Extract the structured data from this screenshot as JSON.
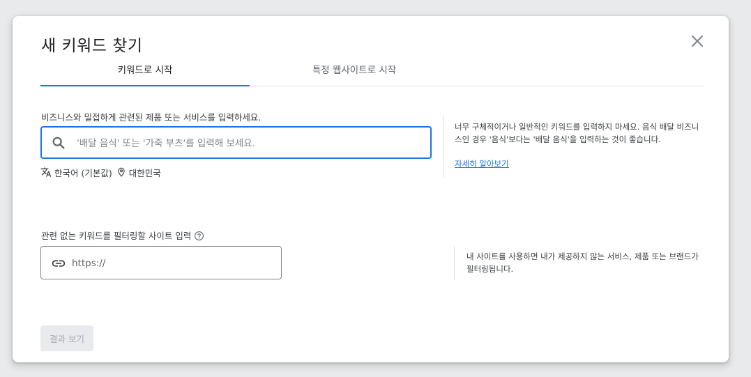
{
  "dialog": {
    "title": "새 키워드 찾기",
    "close_icon": "close-icon"
  },
  "tabs": [
    {
      "label": "키워드로 시작",
      "active": true
    },
    {
      "label": "특정 웹사이트로 시작",
      "active": false
    }
  ],
  "keyword_section": {
    "label": "비즈니스와 밀접하게 관련된 제품 또는 서비스를 입력하세요.",
    "search_placeholder": "'배달 음식' 또는 '가죽 부츠'를 입력해 보세요.",
    "search_value": "",
    "language": "한국어 (기본값)",
    "location": "대한민국",
    "help_text": "너무 구체적이거나 일반적인 키워드를 입력하지 마세요. 음식 배달 비즈니스인 경우 '음식'보다는 '배달 음식'을 입력하는 것이 좋습니다.",
    "help_link": "자세히 알아보기"
  },
  "site_section": {
    "label": "관련 없는 키워드를 필터링할 사이트 입력",
    "url_placeholder": "https://",
    "help_text": "내 사이트를 사용하면 내가 제공하지 않는 서비스, 제품 또는 브랜드가 필터링됩니다."
  },
  "actions": {
    "results_label": "결과 보기",
    "results_enabled": false
  },
  "colors": {
    "accent": "#1a73e8",
    "text": "#3c4043",
    "disabled_bg": "#e8eaed",
    "disabled_text": "#a8abaf"
  }
}
